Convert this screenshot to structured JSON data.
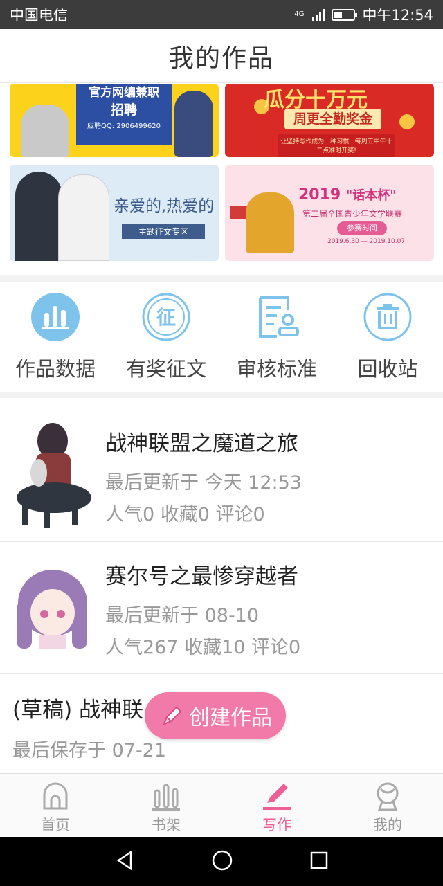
{
  "status_bar": {
    "carrier": "中国电信",
    "network": "4G",
    "time": "中午12:54"
  },
  "header": {
    "title": "我的作品"
  },
  "banners": [
    {
      "id": "recruit",
      "lines": [
        "官方网编兼职",
        "招聘",
        "应聘QQ: 2906499620"
      ]
    },
    {
      "id": "bonus",
      "lines": [
        "瓜分十万元",
        "周更全勤奖金",
        "让坚持写作成为一种习惯 · 每周五中午十二点准时开奖!"
      ]
    },
    {
      "id": "theme",
      "lines": [
        "亲爱的,热爱的",
        "主题征文专区"
      ]
    },
    {
      "id": "contest",
      "lines": [
        "2019",
        "\"话本杯\"",
        "第二届全国青少年文学联赛",
        "参赛时间",
        "2019.6.30 — 2019.10.07"
      ]
    }
  ],
  "actions": [
    {
      "label": "作品数据",
      "icon": "bar-chart-icon"
    },
    {
      "label": "有奖征文",
      "icon": "contest-icon"
    },
    {
      "label": "审核标准",
      "icon": "review-document-icon"
    },
    {
      "label": "回收站",
      "icon": "trash-icon"
    }
  ],
  "works": [
    {
      "title": "战神联盟之魔道之旅",
      "updated": "最后更新于 今天 12:53",
      "stats": "人气0 收藏0 评论0"
    },
    {
      "title": "赛尔号之最惨穿越者",
      "updated": "最后更新于 08-10",
      "stats": "人气267 收藏10 评论0"
    },
    {
      "title": "(草稿) 战神联",
      "updated": "最后保存于 07-21"
    }
  ],
  "fab": {
    "label": "创建作品"
  },
  "bottom_nav": [
    {
      "label": "首页",
      "icon": "home-icon",
      "active": false
    },
    {
      "label": "书架",
      "icon": "bookshelf-icon",
      "active": false
    },
    {
      "label": "写作",
      "icon": "pen-icon",
      "active": true
    },
    {
      "label": "我的",
      "icon": "profile-icon",
      "active": false
    }
  ],
  "colors": {
    "accent": "#ee5f95",
    "icon_blue": "#7ec3ec",
    "fab": "#f27aa8"
  }
}
